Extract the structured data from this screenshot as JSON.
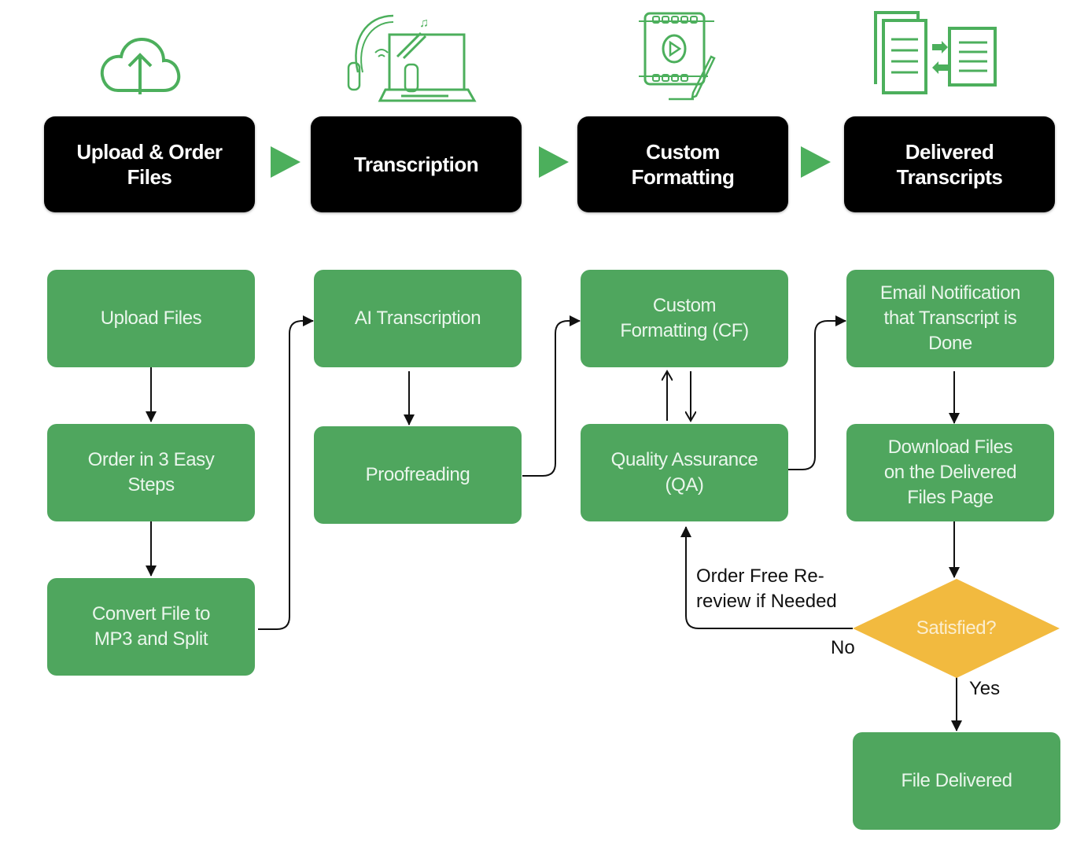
{
  "colors": {
    "stage_bg": "#000000",
    "step_bg": "#4fa65e",
    "decision_bg": "#f2ba3f",
    "icon_green": "#4caf5c",
    "connector": "#111111"
  },
  "icons": [
    "cloud-upload-icon",
    "headphones-laptop-icon",
    "video-edit-icon",
    "documents-exchange-icon"
  ],
  "stages": [
    {
      "label": "Upload & Order\nFiles"
    },
    {
      "label": "Transcription"
    },
    {
      "label": "Custom\nFormatting"
    },
    {
      "label": "Delivered\nTranscripts"
    }
  ],
  "steps": {
    "upload_files": "Upload Files",
    "order_steps": "Order in 3 Easy\nSteps",
    "convert_file": "Convert File to\nMP3 and Split",
    "ai_transcription": "AI Transcription",
    "proofreading": "Proofreading",
    "custom_formatting": "Custom\nFormatting (CF)",
    "quality_assurance": "Quality Assurance\n(QA)",
    "email_notification": "Email Notification\nthat Transcript is\nDone",
    "download_files": "Download Files\non the Delivered\nFiles Page",
    "file_delivered": "File Delivered"
  },
  "decision": {
    "label": "Satisfied?"
  },
  "edge_labels": {
    "rereview": "Order Free Re-\nreview if Needed",
    "no": "No",
    "yes": "Yes"
  }
}
